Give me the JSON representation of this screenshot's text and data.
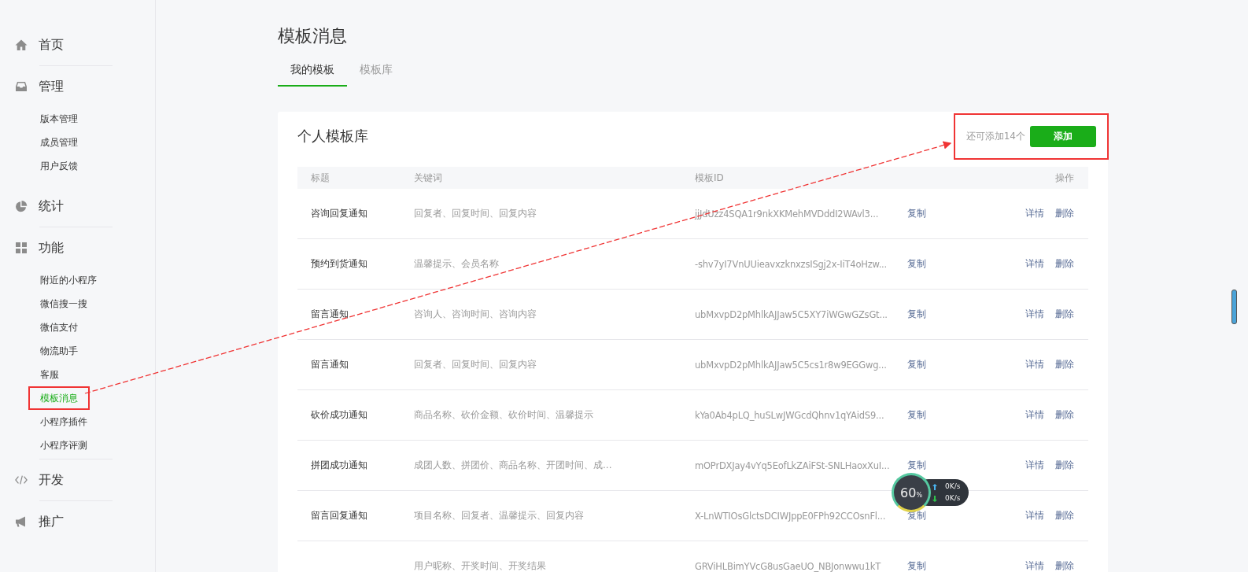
{
  "sidebar": {
    "groups": [
      {
        "title": "首页",
        "divider_above": false
      },
      {
        "title": "管理",
        "divider_above": true,
        "items": [
          {
            "label": "版本管理",
            "selected": false,
            "boxed": false
          },
          {
            "label": "成员管理",
            "selected": false,
            "boxed": false
          },
          {
            "label": "用户反馈",
            "selected": false,
            "boxed": false
          }
        ]
      },
      {
        "title": "统计",
        "divider_above": false
      },
      {
        "title": "功能",
        "divider_above": true,
        "items": [
          {
            "label": "附近的小程序",
            "selected": false,
            "boxed": false
          },
          {
            "label": "微信搜一搜",
            "selected": false,
            "boxed": false
          },
          {
            "label": "微信支付",
            "selected": false,
            "boxed": false
          },
          {
            "label": "物流助手",
            "selected": false,
            "boxed": false
          },
          {
            "label": "客服",
            "selected": false,
            "boxed": false
          },
          {
            "label": "模板消息",
            "selected": true,
            "boxed": true
          },
          {
            "label": "小程序插件",
            "selected": false,
            "boxed": false
          },
          {
            "label": "小程序评测",
            "selected": false,
            "boxed": false
          }
        ]
      },
      {
        "title": "开发",
        "divider_above": true
      },
      {
        "title": "推广",
        "divider_above": true
      }
    ]
  },
  "page_title": "模板消息",
  "tabs": [
    {
      "label": "我的模板",
      "selected": true
    },
    {
      "label": "模板库",
      "selected": false
    }
  ],
  "card": {
    "title": "个人模板库",
    "remaining": "还可添加14个",
    "add_button": "添加",
    "boxed": true,
    "table": {
      "columns": [
        "标题",
        "关键词",
        "模板ID",
        "操作"
      ],
      "rows": [
        {
          "title": "咨询回复通知",
          "keywords": "回复者、回复时间、回复内容",
          "template_id": "jjJdUzz4SQA1r9nkXKMehMVDddI2WAvl3...",
          "copy": "复制",
          "detail": "详情",
          "delete": "删除"
        },
        {
          "title": "预约到货通知",
          "keywords": "温馨提示、会员名称",
          "template_id": "-shv7yI7VnUUieavxzknxzsISgj2x-IiT4oHzw...",
          "copy": "复制",
          "detail": "详情",
          "delete": "删除"
        },
        {
          "title": "留言通知",
          "keywords": "咨询人、咨询时间、咨询内容",
          "template_id": "ubMxvpD2pMhlkAJJaw5C5XY7iWGwGZsGt...",
          "copy": "复制",
          "detail": "详情",
          "delete": "删除"
        },
        {
          "title": "留言通知",
          "keywords": "回复者、回复时间、回复内容",
          "template_id": "ubMxvpD2pMhlkAJJaw5C5cs1r8w9EGGwg...",
          "copy": "复制",
          "detail": "详情",
          "delete": "删除"
        },
        {
          "title": "砍价成功通知",
          "keywords": "商品名称、砍价金额、砍价时间、温馨提示",
          "template_id": "kYa0Ab4pLQ_huSLwJWGcdQhnv1qYAidS9...",
          "copy": "复制",
          "detail": "详情",
          "delete": "删除"
        },
        {
          "title": "拼团成功通知",
          "keywords": "成团人数、拼团价、商品名称、开团时间、成...",
          "template_id": "mOPrDXJay4vYq5EofLkZAiFSt-SNLHaoxXuI...",
          "copy": "复制",
          "detail": "详情",
          "delete": "删除"
        },
        {
          "title": "留言回复通知",
          "keywords": "项目名称、回复者、温馨提示、回复内容",
          "template_id": "X-LnWTIOsGlctsDCIWJppE0FPh92CCOsnFl...",
          "copy": "复制",
          "detail": "详情",
          "delete": "删除"
        },
        {
          "keywords": "用户昵称、开奖时间、开奖结果",
          "template_id": "GRViHLBimYVcG8usGaeUO_NBJonwwu1kT",
          "copy": "复制",
          "detail": "详情",
          "delete": "删除"
        }
      ]
    }
  },
  "speed_widget": {
    "percent": "60",
    "unit": "%",
    "up": "0K/s",
    "down": "0K/s"
  }
}
